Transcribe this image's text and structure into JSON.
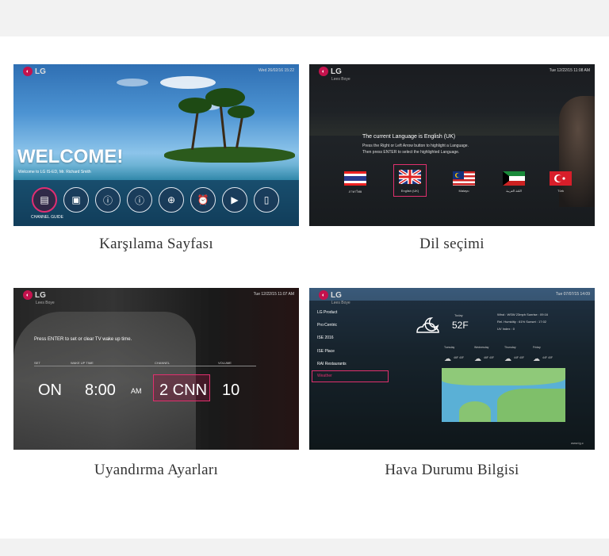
{
  "captions": {
    "p1": "Karşılama Sayfası",
    "p2": "Dil seçimi",
    "p3": "Uyandırma Ayarları",
    "p4": "Hava Durumu Bilgisi"
  },
  "brand": {
    "logo_text": "LG",
    "accent": "#c4124d",
    "highlight": "#e0306e"
  },
  "welcome": {
    "date": "Wed 26/02/16 15:22",
    "title": "WELCOME!",
    "subtitle": "Welcome to LG IS-ED, Mr. Richard Smith",
    "selected_label": "CHANNEL GUIDE"
  },
  "language": {
    "sub": "Lees Boye",
    "date": "Tue 12/22/15 11:08 AM",
    "current": "The current Language is English (UK)",
    "instr1": "Press the Right or Left Arrow button to highlight a Language.",
    "instr2": "Then press ENTER to select the highlighted Language.",
    "flags": [
      {
        "label": "ภาษาไทย"
      },
      {
        "label": "English (UK)"
      },
      {
        "label": "Malayu"
      },
      {
        "label": "اللغة العربية"
      },
      {
        "label": "Türk"
      }
    ]
  },
  "wakeup": {
    "sub": "Lees Boye",
    "date": "Tue 12/22/15 11:07 AM",
    "prompt": "Press ENTER to set or clear TV wake up time.",
    "labels": {
      "set": "SET",
      "time": "WAKE UP TIME",
      "channel": "CHANNEL",
      "volume": "VOLUME"
    },
    "values": {
      "set": "ON",
      "time": "8:00",
      "ampm": "AM",
      "channel": "2 CNN",
      "volume": "10"
    }
  },
  "weather": {
    "sub": "Lees Boye",
    "date": "Tue 07/07/15 14:09",
    "menu": [
      "LG Product",
      "Pro:Centric",
      "ISE 2016",
      "ISE Place",
      "RAI Restaurants",
      "Weather"
    ],
    "today": "Today",
    "temp": "52F",
    "wind": "Wind : WSW 23mph  Sunrise : 09:16",
    "humidity": "Rel. Humidity : 61%  Sunset : 17:02",
    "uv": "UV Index : 0",
    "forecast": [
      {
        "day": "Tuesday",
        "temp": "46F 40F"
      },
      {
        "day": "Wednesday",
        "temp": "46F 40F"
      },
      {
        "day": "Thursday",
        "temp": "44F 40F"
      },
      {
        "day": "Friday",
        "temp": "44F 40F"
      }
    ],
    "footer": "www.lg.c"
  }
}
